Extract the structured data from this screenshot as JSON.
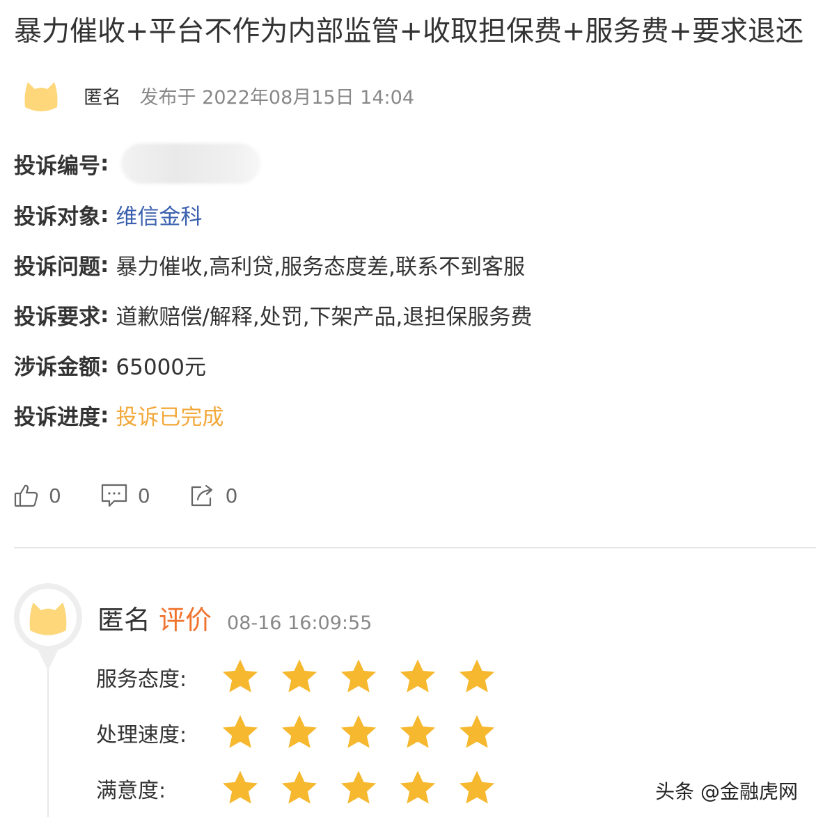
{
  "post": {
    "title": "暴力催收+平台不作为内部监管+收取担保费+服务费+要求退还",
    "author": "匿名",
    "posted": "发布于 2022年08月15日 14:04"
  },
  "fields": {
    "number": {
      "label": "投诉编号",
      "colon": ":"
    },
    "target": {
      "label": "投诉对象",
      "colon": ":",
      "value": "维信金科"
    },
    "issue": {
      "label": "投诉问题",
      "colon": ":",
      "value": "暴力催收,高利贷,服务态度差,联系不到客服"
    },
    "request": {
      "label": "投诉要求",
      "colon": ":",
      "value": "道歉赔偿/解释,处罚,下架产品,退担保服务费"
    },
    "amount": {
      "label": "涉诉金额",
      "colon": ":",
      "value": "65000元"
    },
    "progress": {
      "label": "投诉进度",
      "colon": ":",
      "value": "投诉已完成"
    }
  },
  "actions": {
    "like_count": "0",
    "comment_count": "0",
    "share_count": "0"
  },
  "review": {
    "author": "匿名",
    "tag": "评价",
    "time": "08-16 16:09:55",
    "ratings": [
      {
        "label": "服务态度:",
        "stars": 5
      },
      {
        "label": "处理速度:",
        "stars": 5
      },
      {
        "label": "满意度:",
        "stars": 5
      }
    ]
  },
  "watermark": "头条 @金融虎网",
  "colors": {
    "link": "#3a5fae",
    "status_done": "#f2a93b",
    "review_tag": "#f0732e",
    "star": "#f5b82e",
    "avatar": "#fdd77a"
  }
}
